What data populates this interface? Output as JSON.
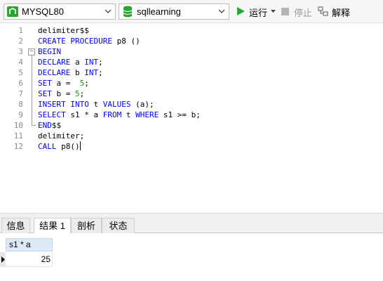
{
  "toolbar": {
    "connection": "MYSQL80",
    "database": "sqllearning",
    "run_label": "运行",
    "stop_label": "停止",
    "explain_label": "解释"
  },
  "editor": {
    "line_numbers": [
      "1",
      "2",
      "3",
      "4",
      "5",
      "6",
      "7",
      "8",
      "9",
      "10",
      "11",
      "12"
    ],
    "lines": [
      "delimiter$$",
      "CREATE PROCEDURE p8 ()",
      "BEGIN",
      "DECLARE a INT;",
      "DECLARE b INT;",
      "SET a =  5;",
      "SET b = 5;",
      "INSERT INTO t VALUES (a);",
      "SELECT s1 * a FROM t WHERE s1 >= b;",
      "END$$",
      "delimiter;",
      "CALL p8()"
    ]
  },
  "result_tabs": [
    "信息",
    "结果 1",
    "剖析",
    "状态"
  ],
  "active_tab": "结果 1",
  "result_grid": {
    "columns": [
      "s1 * a"
    ],
    "rows": [
      [
        "25"
      ]
    ]
  },
  "colors": {
    "keyword": "#0000ff",
    "number": "#1a9a1a",
    "run_green": "#2aa52f",
    "header_blue": "#dce9f7"
  },
  "icons": [
    "connection-icon",
    "database-icon",
    "run-icon",
    "stop-icon",
    "explain-icon",
    "chevron-down-icon",
    "fold-icon",
    "row-pointer-icon"
  ]
}
